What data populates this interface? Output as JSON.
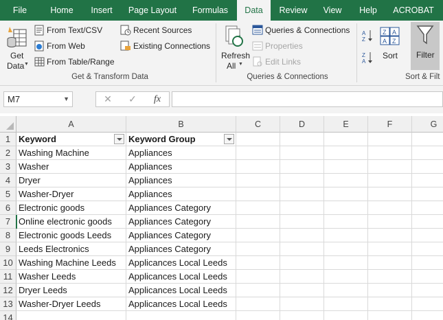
{
  "tabs": [
    {
      "label": "File"
    },
    {
      "label": "Home"
    },
    {
      "label": "Insert"
    },
    {
      "label": "Page Layout"
    },
    {
      "label": "Formulas"
    },
    {
      "label": "Data"
    },
    {
      "label": "Review"
    },
    {
      "label": "View"
    },
    {
      "label": "Help"
    },
    {
      "label": "ACROBAT"
    }
  ],
  "ribbon": {
    "get_transform": {
      "get_data_line1": "Get",
      "get_data_line2": "Data",
      "from_text_csv": "From Text/CSV",
      "from_web": "From Web",
      "from_table_range": "From Table/Range",
      "recent_sources": "Recent Sources",
      "existing_connections": "Existing Connections",
      "group_label": "Get & Transform Data"
    },
    "queries": {
      "refresh_line1": "Refresh",
      "refresh_line2": "All",
      "queries_connections": "Queries & Connections",
      "properties": "Properties",
      "edit_links": "Edit Links",
      "group_label": "Queries & Connections"
    },
    "sort_filter": {
      "sort": "Sort",
      "filter": "Filter",
      "group_label": "Sort & Filt"
    }
  },
  "formula_bar": {
    "name_box": "M7",
    "cancel_symbol": "✕",
    "enter_symbol": "✓",
    "fx_symbol": "fx",
    "formula": ""
  },
  "sheet": {
    "columns": [
      "A",
      "B",
      "C",
      "D",
      "E",
      "F",
      "G"
    ],
    "row_numbers": [
      "1",
      "2",
      "3",
      "4",
      "5",
      "6",
      "7",
      "8",
      "9",
      "10",
      "11",
      "12",
      "13",
      "14"
    ],
    "header": [
      "Keyword",
      "Keyword Group"
    ],
    "rows": [
      [
        "Washing Machine",
        "Appliances"
      ],
      [
        "Washer",
        "Appliances"
      ],
      [
        "Dryer",
        "Appliances"
      ],
      [
        "Washer-Dryer",
        "Appliances"
      ],
      [
        "Electronic goods",
        "Appliances Category"
      ],
      [
        "Online electronic goods",
        "Appliances Category"
      ],
      [
        "Electronic goods Leeds",
        "Appliances Category"
      ],
      [
        "Leeds Electronics",
        "Appliances Category"
      ],
      [
        "Washing Machine Leeds",
        "Applicances Local Leeds"
      ],
      [
        "Washer Leeds",
        "Applicances Local Leeds"
      ],
      [
        "Dryer Leeds",
        "Applicances Local Leeds"
      ],
      [
        "Washer-Dryer Leeds",
        "Applicances Local Leeds"
      ]
    ]
  },
  "colors": {
    "accent": "#217346",
    "ribbon_bg": "#f3f3f3"
  }
}
